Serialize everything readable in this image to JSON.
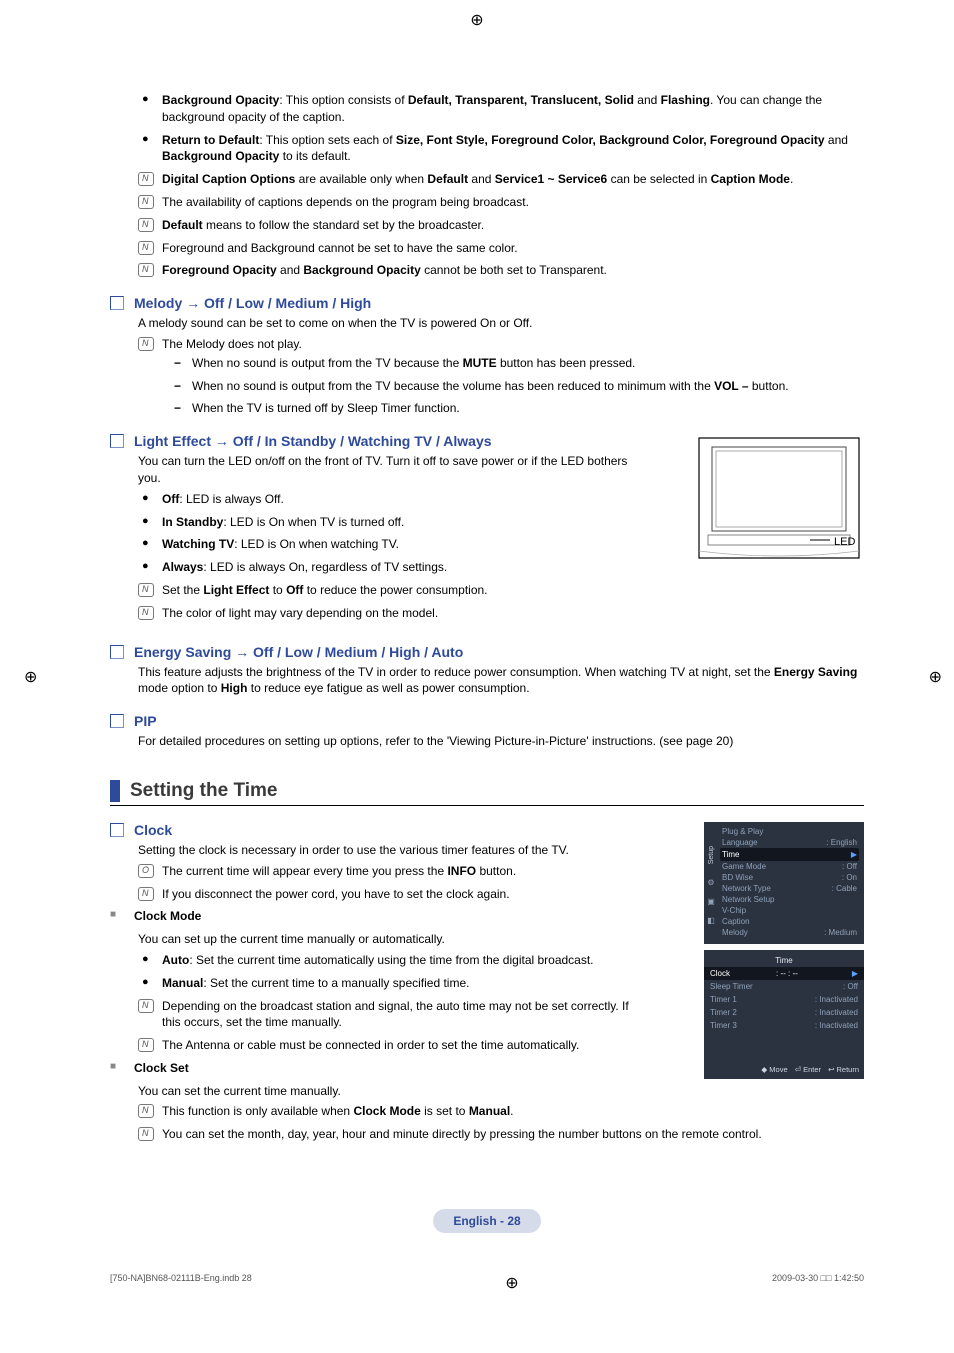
{
  "top_bullets": [
    {
      "lead": "Background Opacity",
      "text": ": This option consists of ",
      "bold1": "Default, Transparent, Translucent, Solid",
      "mid": " and ",
      "bold2": "Flashing",
      "tail": ". You can change the background opacity of the caption."
    },
    {
      "lead": "Return to Default",
      "text": ": This option sets each of ",
      "bold1": "Size, Font Style, Foreground Color, Background Color, Foreground Opacity",
      "mid": " and ",
      "bold2": "Background Opacity",
      "tail": " to its default."
    }
  ],
  "top_notes": [
    {
      "parts": [
        "<b>Digital Caption Options</b> are available only when <b>Default</b> and <b>Service1 ~ Service6</b> can be selected in <b>Caption Mode</b>."
      ]
    },
    {
      "parts": [
        "The availability of captions depends on the program being broadcast."
      ]
    },
    {
      "parts": [
        "<b>Default</b> means to follow the standard set by the broadcaster."
      ]
    },
    {
      "parts": [
        "Foreground and Background cannot be set to have the same color."
      ]
    },
    {
      "parts": [
        "<b>Foreground Opacity</b> and <b>Background Opacity</b> cannot be both set to Transparent."
      ]
    }
  ],
  "melody": {
    "title": "Melody → Off / Low / Medium / High",
    "body": "A melody sound can be set to come on when the TV is powered On or Off.",
    "note_lead": "The Melody does not play.",
    "dashes": [
      "When no sound is output from the TV because the <b>MUTE</b> button has been pressed.",
      "When no sound is output from the TV because the volume has been reduced to minimum with the <b>VOL –</b> button.",
      "When the TV is turned off by Sleep Timer function."
    ]
  },
  "light": {
    "title": "Light Effect → Off / In Standby / Watching TV / Always",
    "body": "You can turn the LED on/off on the front of TV. Turn it off to save power or if the LED bothers you.",
    "bullets": [
      "<b>Off</b>: LED is always Off.",
      "<b>In Standby</b>: LED is On when TV is turned off.",
      "<b>Watching TV</b>: LED is On when watching TV.",
      "<b>Always</b>: LED is always On, regardless of TV settings."
    ],
    "notes": [
      "Set the <b>Light Effect</b> to <b>Off</b> to reduce the power consumption.",
      "The color of light may vary depending on the model."
    ],
    "led_label": "LED"
  },
  "energy": {
    "title": "Energy Saving → Off / Low / Medium / High / Auto",
    "body": "This feature adjusts the brightness of the TV in order to reduce power consumption. When watching TV at night, set the <b>Energy Saving</b> mode option to <b>High</b> to reduce eye fatigue as well as power consumption."
  },
  "pip": {
    "title": "PIP",
    "body": "For detailed procedures on setting up options, refer to the 'Viewing Picture-in-Picture' instructions. (see page 20)"
  },
  "section_time": "Setting the Time",
  "clock": {
    "title": "Clock",
    "body": "Setting the clock is necessary in order to use the various timer features of the TV.",
    "info_note": "The current time will appear every time you press the <b>INFO</b> button.",
    "n_note": "If you disconnect the power cord, you have to set the clock again.",
    "clock_mode": {
      "title": "Clock Mode",
      "body": "You can set up the current time manually or automatically.",
      "bullets": [
        "<b>Auto</b>: Set the current time automatically using the time from the digital broadcast.",
        "<b>Manual</b>: Set the current time to a manually specified time."
      ],
      "notes": [
        "Depending on the broadcast station and signal, the auto time may not be set correctly. If this occurs, set the time manually.",
        "The Antenna or cable must be connected in order to set the time automatically."
      ]
    },
    "clock_set": {
      "title": "Clock Set",
      "body": "You can set the current time manually.",
      "notes": [
        "This function is only available when <b>Clock Mode</b> is set to <b>Manual</b>.",
        "You can set the month, day, year, hour and minute directly by pressing the number buttons on the remote control."
      ]
    }
  },
  "menu1": {
    "side_label": "Setup",
    "rows": [
      {
        "label": "Plug & Play",
        "val": ""
      },
      {
        "label": "Language",
        "val": "English"
      },
      {
        "label": "Time",
        "val": "",
        "hl": true,
        "arrow": true
      },
      {
        "label": "Game Mode",
        "val": "Off"
      },
      {
        "label": "BD Wise",
        "val": "On"
      },
      {
        "label": "Network Type",
        "val": "Cable"
      },
      {
        "label": "Network Setup",
        "val": ""
      },
      {
        "label": "V-Chip",
        "val": ""
      },
      {
        "label": "Caption",
        "val": ""
      },
      {
        "label": "Melody",
        "val": "Medium"
      }
    ]
  },
  "menu2": {
    "title": "Time",
    "rows": [
      {
        "label": "Clock",
        "val": "-- : --",
        "hl": true,
        "arrow": true
      },
      {
        "label": "Sleep Timer",
        "val": "Off"
      },
      {
        "label": "Timer 1",
        "val": "Inactivated"
      },
      {
        "label": "Timer 2",
        "val": "Inactivated"
      },
      {
        "label": "Timer 3",
        "val": "Inactivated"
      }
    ],
    "footer": [
      "◆ Move",
      "⏎ Enter",
      "↩ Return"
    ]
  },
  "page_label": "English - 28",
  "meta_left": "[750-NA]BN68-02111B-Eng.indb   28",
  "meta_right": "2009-03-30   □□ 1:42:50"
}
